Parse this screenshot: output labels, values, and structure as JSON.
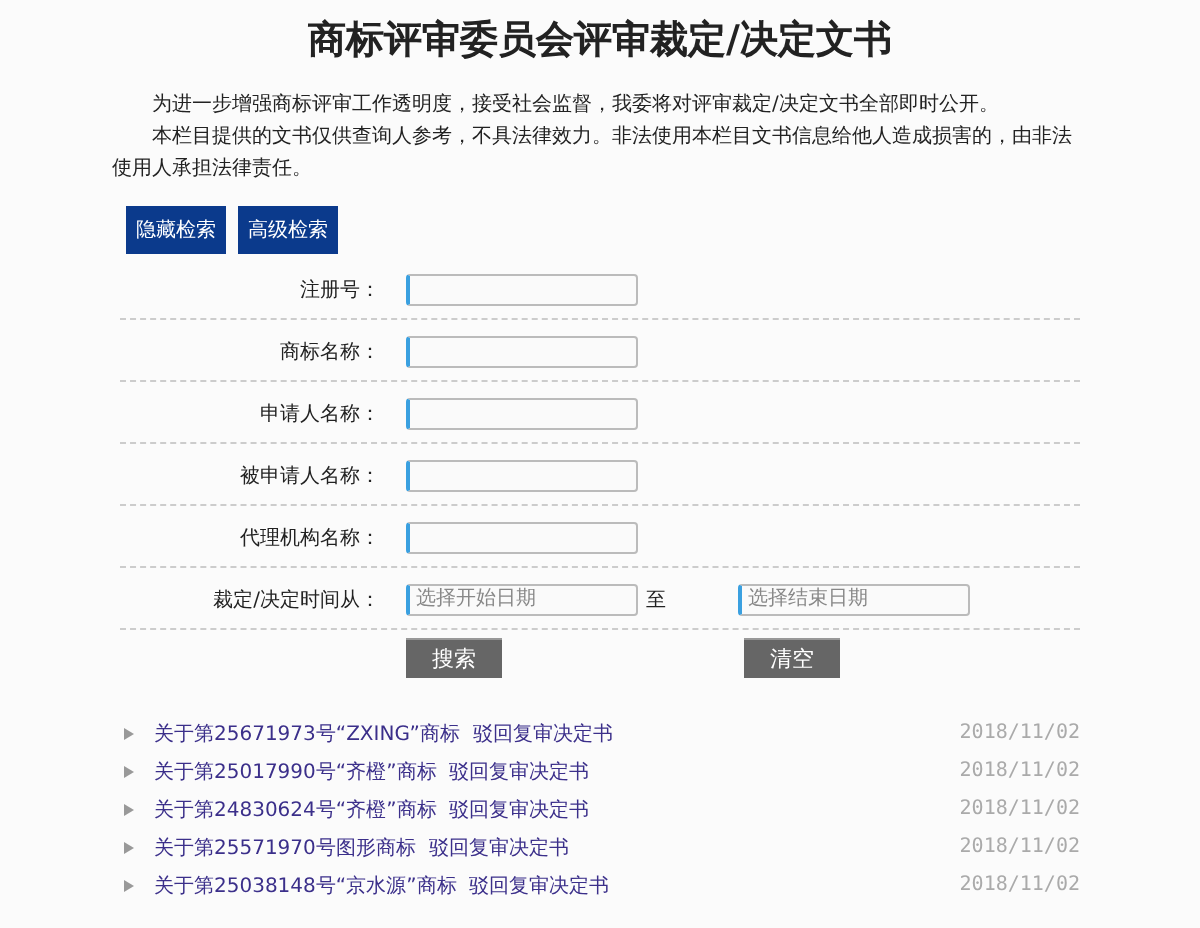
{
  "title": "商标评审委员会评审裁定/决定文书",
  "intro": [
    "为进一步增强商标评审工作透明度，接受社会监督，我委将对评审裁定/决定文书全部即时公开。",
    "本栏目提供的文书仅供查询人参考，不具法律效力。非法使用本栏目文书信息给他人造成损害的，由非法使用人承担法律责任。"
  ],
  "toggles": [
    "隐藏检索",
    "高级检索"
  ],
  "fields": [
    {
      "label": "注册号："
    },
    {
      "label": "商标名称："
    },
    {
      "label": "申请人名称："
    },
    {
      "label": "被申请人名称："
    },
    {
      "label": "代理机构名称："
    }
  ],
  "date_range": {
    "label": "裁定/决定时间从：",
    "start_placeholder": "选择开始日期",
    "separator": "至",
    "end_placeholder": "选择结束日期"
  },
  "actions": [
    "搜索",
    "清空"
  ],
  "results": [
    {
      "title": "关于第25671973号“ZXING”商标  驳回复审决定书",
      "date": "2018/11/02"
    },
    {
      "title": "关于第25017990号“齐橙”商标  驳回复审决定书",
      "date": "2018/11/02"
    },
    {
      "title": "关于第24830624号“齐橙”商标  驳回复审决定书",
      "date": "2018/11/02"
    },
    {
      "title": "关于第25571970号图形商标  驳回复审决定书",
      "date": "2018/11/02"
    },
    {
      "title": "关于第25038148号“京水源”商标  驳回复审决定书",
      "date": "2018/11/02"
    }
  ]
}
